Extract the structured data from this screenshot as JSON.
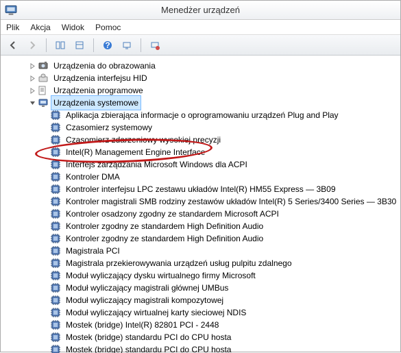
{
  "window": {
    "title": "Menedżer urządzeń"
  },
  "menu": {
    "file": "Plik",
    "action": "Akcja",
    "view": "Widok",
    "help": "Pomoc"
  },
  "tree": {
    "top": [
      {
        "label": "Urządzenia do obrazowania",
        "icon": "imaging"
      },
      {
        "label": "Urządzenia interfejsu HID",
        "icon": "hid"
      },
      {
        "label": "Urządzenia programowe",
        "icon": "software"
      }
    ],
    "systemCategory": {
      "label": "Urządzenia systemowe"
    },
    "systemItems": [
      "Aplikacja zbierająca informacje o oprogramowaniu urządzeń Plug and Play",
      "Czasomierz systemowy",
      "Czasomierz zdarzeniowy wysokiej precyzji",
      "Intel(R) Management Engine Interface",
      "Interfejs zarządzania Microsoft Windows dla ACPI",
      "Kontroler DMA",
      "Kontroler interfejsu LPC zestawu układów Intel(R) HM55 Express — 3B09",
      "Kontroler magistrali SMB rodziny zestawów układów Intel(R) 5 Series/3400 Series — 3B30",
      "Kontroler osadzony zgodny ze standardem Microsoft ACPI",
      "Kontroler zgodny ze standardem High Definition Audio",
      "Kontroler zgodny ze standardem High Definition Audio",
      "Magistrala PCI",
      "Magistrala przekierowywania urządzeń usług pulpitu zdalnego",
      "Moduł wyliczający dysku wirtualnego firmy Microsoft",
      "Moduł wyliczający magistrali głównej UMBus",
      "Moduł wyliczający magistrali kompozytowej",
      "Moduł wyliczający wirtualnej karty sieciowej NDIS",
      "Mostek (bridge) Intel(R) 82801 PCI - 2448",
      "Mostek (bridge) standardu PCI do CPU hosta",
      "Mostek (bridge) standardu PCI do CPU hosta"
    ],
    "selectedIndex": -1,
    "categorySelected": true,
    "circledIndex": 3
  }
}
